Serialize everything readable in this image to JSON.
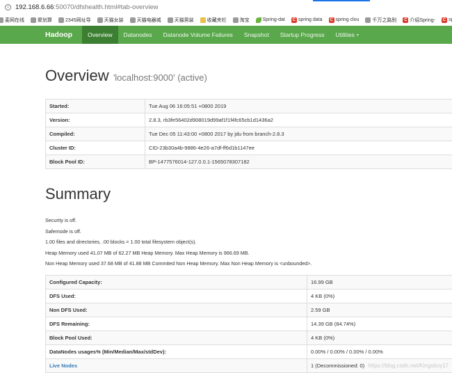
{
  "browser": {
    "url_host": "192.168.6.66",
    "url_rest": ":50070/dfshealth.html#tab-overview",
    "bookmarks": [
      {
        "label": "麦网在线",
        "icon": "bookmark-icon"
      },
      {
        "label": "聚划算",
        "icon": "bookmark-icon"
      },
      {
        "label": "2345网址导",
        "icon": "bookmark-icon"
      },
      {
        "label": "天猫女装",
        "icon": "bookmark-icon"
      },
      {
        "label": "天猫电器城",
        "icon": "bookmark-icon"
      },
      {
        "label": "天猫男装",
        "icon": "bookmark-icon"
      },
      {
        "label": "收藏夹栏",
        "icon": "folder-icon"
      },
      {
        "label": "淘宝",
        "icon": "bookmark-icon"
      },
      {
        "label": "Spring-dat",
        "icon": "spring-icon"
      },
      {
        "label": "spring data",
        "icon": "csdn-icon"
      },
      {
        "label": "spring clou",
        "icon": "csdn-icon"
      },
      {
        "label": "千万之路别",
        "icon": "bookmark-icon"
      },
      {
        "label": "介绍Spring-",
        "icon": "csdn-icon"
      },
      {
        "label": "springboot",
        "icon": "csdn-icon"
      }
    ]
  },
  "navbar": {
    "brand": "Hadoop",
    "items": [
      "Overview",
      "Datanodes",
      "Datanode Volume Failures",
      "Snapshot",
      "Startup Progress",
      "Utilities"
    ],
    "active": "Overview"
  },
  "overview": {
    "title": "Overview",
    "subtitle": "'localhost:9000' (active)",
    "rows": [
      {
        "key": "Started:",
        "value": "Tue Aug 06 16:05:51 +0800 2019"
      },
      {
        "key": "Version:",
        "value": "2.8.3, rb3fe56402d908019d99af1f1f4fc65cb1d1436a2"
      },
      {
        "key": "Compiled:",
        "value": "Tue Dec 05 11:43:00 +0800 2017 by jdu from branch-2.8.3"
      },
      {
        "key": "Cluster ID:",
        "value": "CID-23b30a4b-9886-4e26-a7df-ff6d1b1147ee"
      },
      {
        "key": "Block Pool ID:",
        "value": "BP-1477576014-127.0.0.1-1565078307182"
      }
    ]
  },
  "summary": {
    "title": "Summary",
    "lines": [
      "Security is off.",
      "Safemode is off.",
      "1.00 files and directories, .00 blocks = 1.00 total filesystem object(s).",
      "Heap Memory used 41.07 MB of 62.27 MB Heap Memory. Max Heap Memory is 966.69 MB.",
      "Non Heap Memory used 37.68 MB of 41.88 MB Commited Non Heap Memory. Max Non Heap Memory is <unbounded>."
    ],
    "rows": [
      {
        "key": "Configured Capacity:",
        "value": "16.99 GB"
      },
      {
        "key": "DFS Used:",
        "value": "4 KB (0%)"
      },
      {
        "key": "Non DFS Used:",
        "value": "2.59 GB"
      },
      {
        "key": "DFS Remaining:",
        "value": "14.39 GB (84.74%)"
      },
      {
        "key": "Block Pool Used:",
        "value": "4 KB (0%)"
      },
      {
        "key": "DataNodes usages% (Min/Median/Max/stdDev):",
        "value": "0.00% / 0.00% / 0.00% / 0.00%"
      },
      {
        "key": "Live Nodes",
        "value": "1 (Decommissioned: 0)",
        "link": true
      }
    ]
  },
  "watermark": "https://blog.csdn.net/Kingsboy17"
}
